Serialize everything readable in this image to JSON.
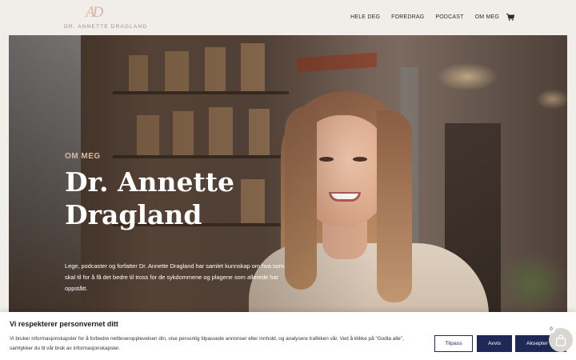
{
  "header": {
    "logo_mark": "AD",
    "logo_text": "DR. ANNETTE DRAGLAND",
    "nav": [
      "HELE DEG",
      "FOREDRAG",
      "PODCAST",
      "OM MEG"
    ],
    "cart_icon": "shopping-cart-icon"
  },
  "hero": {
    "eyebrow": "OM MEG",
    "headline_line1": "Dr. Annette",
    "headline_line2": "Dragland",
    "lede": "Lege, podcaster og forfatter Dr. Annette Dragland har samlet kunnskap om hva som skal til for å få det bedre til tross for de sykdommene og plagene som allerede har oppstått."
  },
  "cookie_banner": {
    "title": "Vi respekterer personvernet ditt",
    "text": "Vi bruker informasjonskapsler for å forbedre nettleseropplevelsen din, vise personlig tilpassede annonser eller innhold, og analysere trafikken vår. Ved å klikke på \"Godta alle\", samtykker du til vår bruk av informasjonskapsler.",
    "buttons": {
      "customize": "Tilpass",
      "reject": "Avvis",
      "accept": "Aksepter alle"
    }
  },
  "floating_cart": {
    "count": "0",
    "icon": "shopping-bag-icon"
  },
  "colors": {
    "background": "#f1eeea",
    "accent_navy": "#1e2a55",
    "eyebrow": "#d8b9a4"
  }
}
